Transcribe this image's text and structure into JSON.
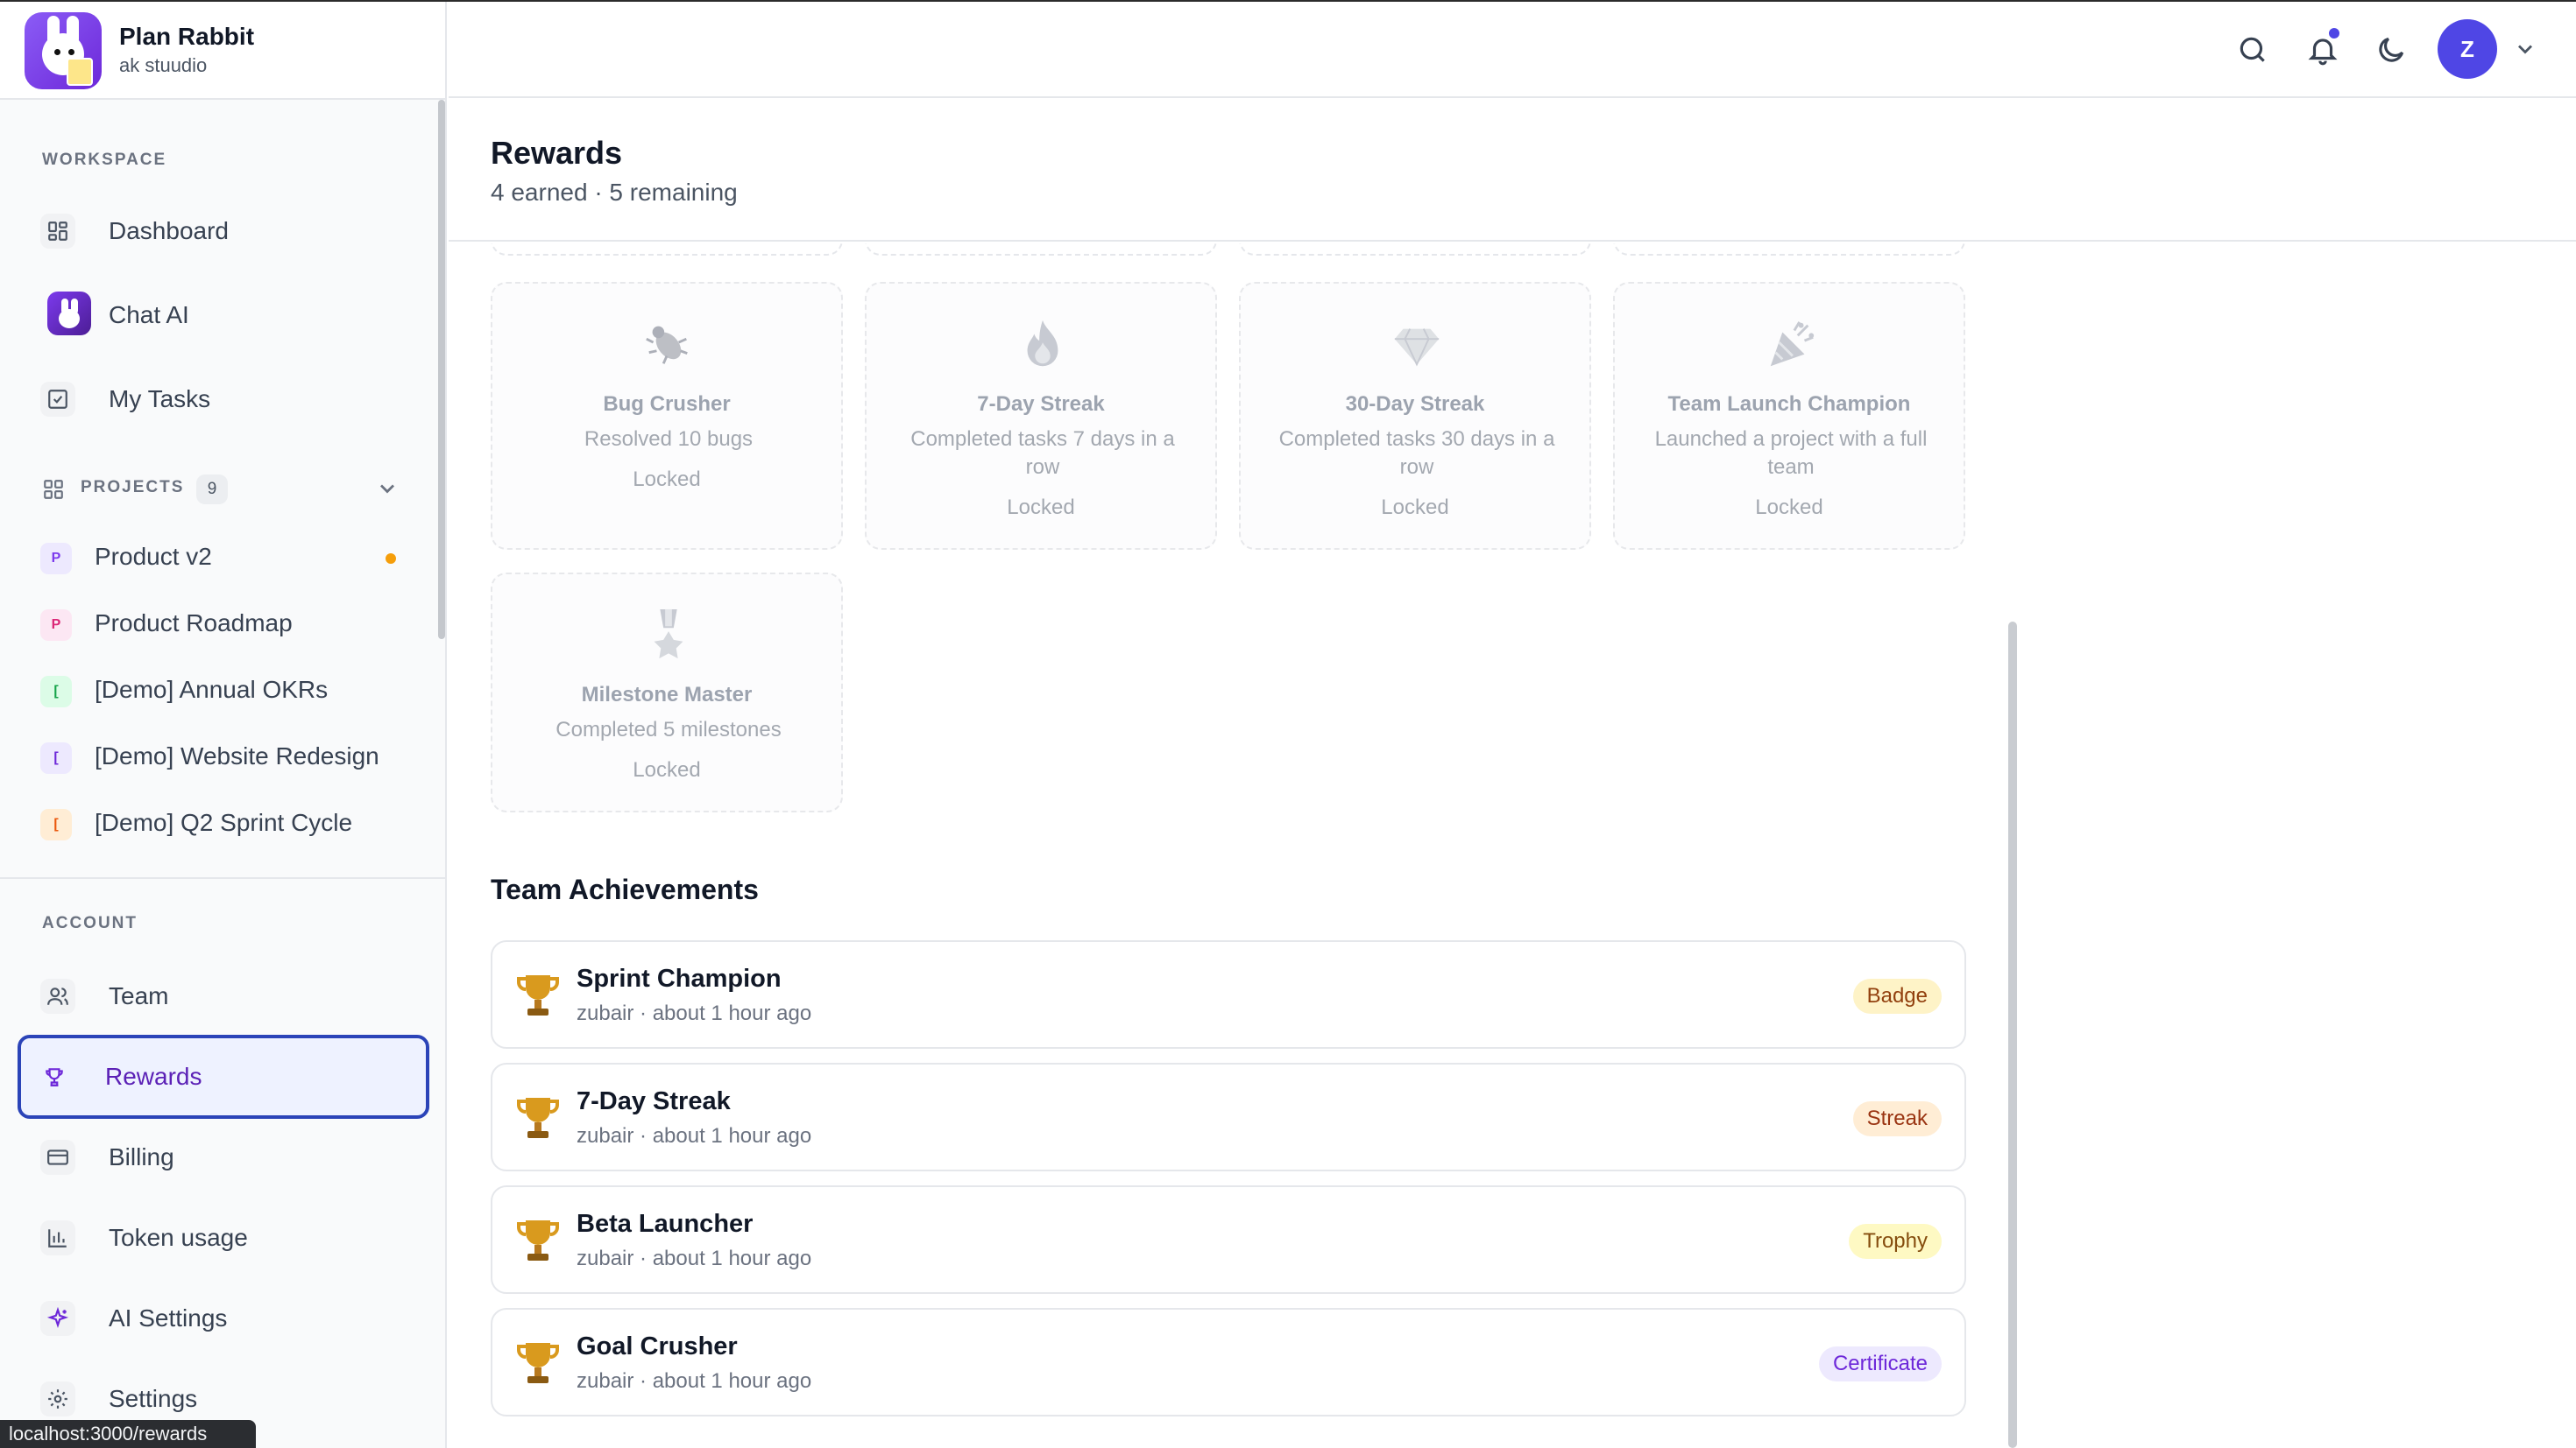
{
  "brand": {
    "title": "Plan Rabbit",
    "subtitle": "ak stuudio"
  },
  "sidebar": {
    "workspace_label": "WORKSPACE",
    "workspace_items": [
      {
        "label": "Dashboard",
        "icon": "grid-icon"
      },
      {
        "label": "Chat AI",
        "icon": "rabbit-icon"
      },
      {
        "label": "My Tasks",
        "icon": "checkbox-icon"
      }
    ],
    "projects_label": "PROJECTS",
    "projects_count": "9",
    "projects": [
      {
        "badge": "P",
        "label": "Product v2",
        "badge_bg": "#ede9fe",
        "badge_fg": "#7c3aed",
        "dot": true
      },
      {
        "badge": "P",
        "label": "Product Roadmap",
        "badge_bg": "#fce7f3",
        "badge_fg": "#db2777"
      },
      {
        "badge": "[",
        "label": "[Demo] Annual OKRs",
        "badge_bg": "#dcfce7",
        "badge_fg": "#16a34a"
      },
      {
        "badge": "[",
        "label": "[Demo] Website Redesign",
        "badge_bg": "#ede9fe",
        "badge_fg": "#6d28d9"
      },
      {
        "badge": "[",
        "label": "[Demo] Q2 Sprint Cycle",
        "badge_bg": "#ffedd5",
        "badge_fg": "#ea580c"
      }
    ],
    "account_label": "ACCOUNT",
    "account_items": [
      {
        "label": "Team",
        "icon": "users-icon"
      },
      {
        "label": "Rewards",
        "icon": "trophy-icon",
        "active": true
      },
      {
        "label": "Billing",
        "icon": "credit-card-icon"
      },
      {
        "label": "Token usage",
        "icon": "bar-chart-icon"
      },
      {
        "label": "AI Settings",
        "icon": "sparkles-icon"
      },
      {
        "label": "Settings",
        "icon": "gear-icon"
      }
    ]
  },
  "header": {
    "avatar_initial": "Z"
  },
  "page": {
    "title": "Rewards",
    "subtitle": "4 earned · 5 remaining"
  },
  "locked_rewards": [
    {
      "title": "Bug Crusher",
      "description": "Resolved 10 bugs",
      "state": "Locked",
      "icon": "bug-icon"
    },
    {
      "title": "7-Day Streak",
      "description": "Completed tasks 7 days in a row",
      "state": "Locked",
      "icon": "fire-icon"
    },
    {
      "title": "30-Day Streak",
      "description": "Completed tasks 30 days in a row",
      "state": "Locked",
      "icon": "diamond-icon"
    },
    {
      "title": "Team Launch Champion",
      "description": "Launched a project with a full team",
      "state": "Locked",
      "icon": "party-popper-icon"
    },
    {
      "title": "Milestone Master",
      "description": "Completed 5 milestones",
      "state": "Locked",
      "icon": "medal-icon"
    }
  ],
  "team_achievements": {
    "title": "Team Achievements",
    "items": [
      {
        "name": "Sprint Champion",
        "meta": "zubair · about 1 hour ago",
        "tag": "Badge"
      },
      {
        "name": "7-Day Streak",
        "meta": "zubair · about 1 hour ago",
        "tag": "Streak"
      },
      {
        "name": "Beta Launcher",
        "meta": "zubair · about 1 hour ago",
        "tag": "Trophy"
      },
      {
        "name": "Goal Crusher",
        "meta": "zubair · about 1 hour ago",
        "tag": "Certificate"
      }
    ]
  },
  "status_url": "localhost:3000/rewards",
  "colors": {
    "accent": "#4f46e5",
    "active_text": "#5b21b6",
    "active_border": "#2b44b8"
  }
}
